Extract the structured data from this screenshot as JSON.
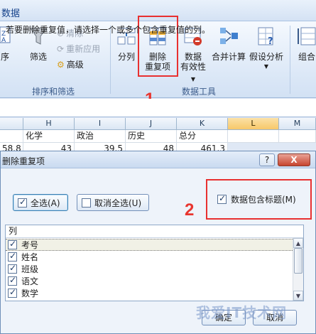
{
  "ribbon": {
    "tab_title": "数据",
    "sort_group": {
      "sort_label": "序",
      "filter_label": "筛选",
      "clear_label": "清除",
      "reapply_label": "重新应用",
      "advanced_label": "高级",
      "group_label": "排序和筛选"
    },
    "tools_group": {
      "split_label": "分列",
      "remove_dup_line1": "删除",
      "remove_dup_line2": "重复项",
      "validation_line1": "数据",
      "validation_line2": "有效性",
      "consolidate_label": "合并计算",
      "whatif_label": "假设分析",
      "group_label": "数据工具"
    },
    "outline_group": {
      "group_label": "组合"
    }
  },
  "annotations": {
    "marker_1": "1",
    "marker_2": "2"
  },
  "sheet": {
    "columns": [
      "H",
      "I",
      "J",
      "K",
      "L",
      "M"
    ],
    "selected_column": "L",
    "header_row": [
      "化学",
      "政治",
      "历史",
      "总分"
    ],
    "data_row": [
      "58.8",
      "43",
      "39.5",
      "48",
      "461.3"
    ]
  },
  "dialog": {
    "title": "删除重复项",
    "help_button": "?",
    "close_button": "X",
    "instruction": "若要删除重复值，请选择一个或多个包含重复值的列。",
    "select_all_label": "全选(A)",
    "unselect_all_label": "取消全选(U)",
    "has_headers_label": "数据包含标题(M)",
    "has_headers_checked": true,
    "list_header": "列",
    "columns": [
      {
        "name": "考号",
        "checked": true
      },
      {
        "name": "姓名",
        "checked": true
      },
      {
        "name": "班级",
        "checked": true
      },
      {
        "name": "语文",
        "checked": true
      },
      {
        "name": "数学",
        "checked": true
      }
    ],
    "ok_label": "确定",
    "cancel_label": "取消"
  },
  "watermark": "我爱IT技术网",
  "colors": {
    "highlight_red": "#e83030",
    "ribbon_blue": "#dce8f7"
  }
}
